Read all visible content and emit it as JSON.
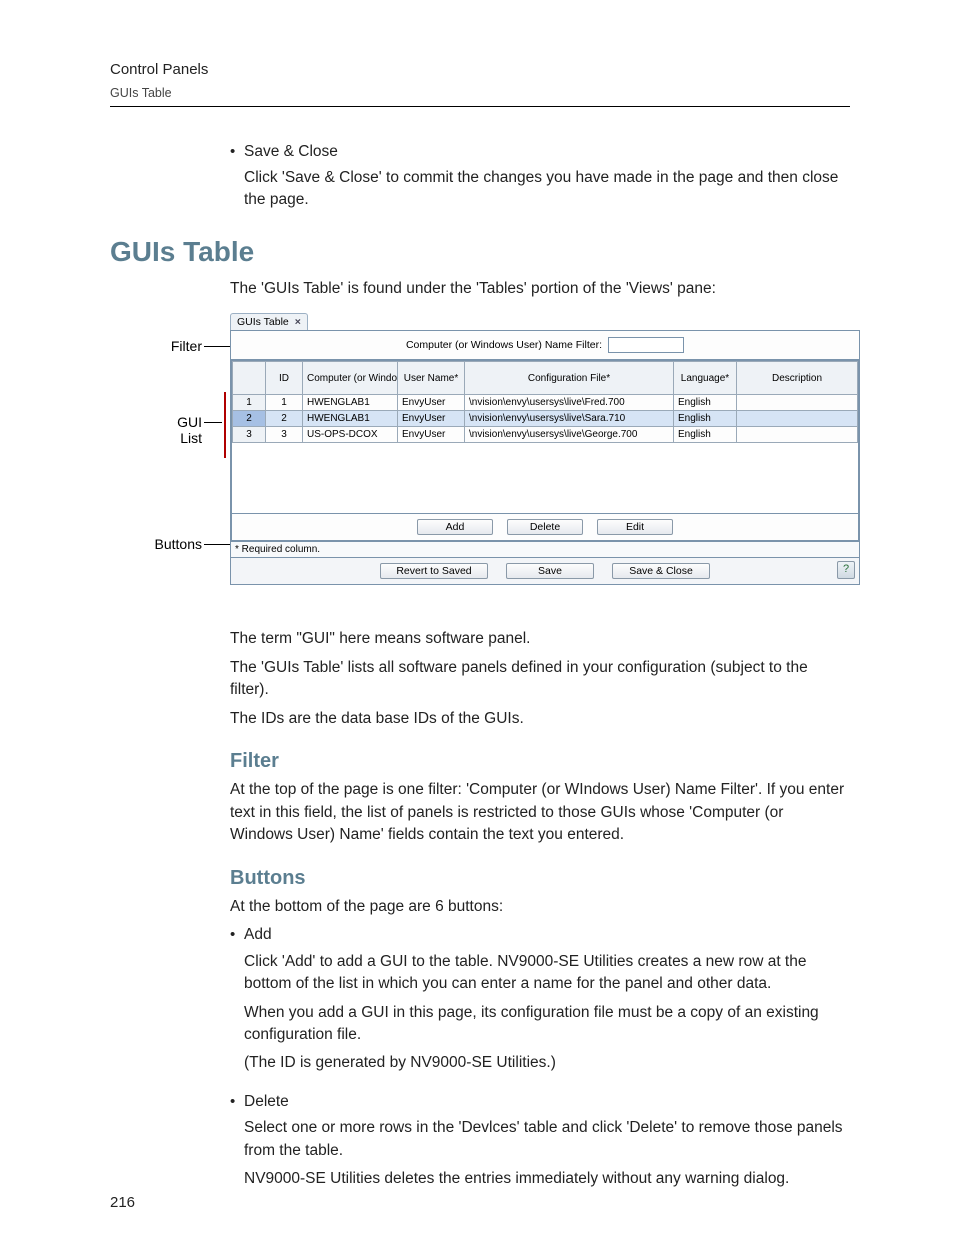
{
  "header": {
    "title": "Control Panels",
    "subtitle": "GUIs Table"
  },
  "intro_bullet": {
    "label": "Save & Close",
    "desc": "Click 'Save & Close' to commit the changes you have made in the page and then close the page."
  },
  "h1": "GUIs Table",
  "p1": "The 'GUIs Table' is found under the 'Tables' portion of the 'Views' pane:",
  "callouts": {
    "filter": "Filter",
    "gui_list_l1": "GUI",
    "gui_list_l2": "List",
    "buttons": "Buttons"
  },
  "app": {
    "tab": "GUIs Table",
    "filter_label": "Computer (or Windows User) Name Filter:",
    "filter_value": "",
    "columns": {
      "blank": "",
      "id": "ID",
      "name": "Computer (or Windows User) Name*",
      "user": "User Name*",
      "cfg": "Configuration File*",
      "lang": "Language*",
      "desc": "Description"
    },
    "rows": [
      {
        "n": "1",
        "id": "1",
        "name": "HWENGLAB1",
        "user": "EnvyUser",
        "cfg": "\\nvision\\envy\\usersys\\live\\Fred.700",
        "lang": "English",
        "desc": ""
      },
      {
        "n": "2",
        "id": "2",
        "name": "HWENGLAB1",
        "user": "EnvyUser",
        "cfg": "\\nvision\\envy\\usersys\\live\\Sara.710",
        "lang": "English",
        "desc": ""
      },
      {
        "n": "3",
        "id": "3",
        "name": "US-OPS-DCOX",
        "user": "EnvyUser",
        "cfg": "\\nvision\\envy\\usersys\\live\\George.700",
        "lang": "English",
        "desc": ""
      }
    ],
    "action_buttons": {
      "add": "Add",
      "delete": "Delete",
      "edit": "Edit"
    },
    "req_note": "* Required column.",
    "bottom_buttons": {
      "revert": "Revert to Saved",
      "save": "Save",
      "save_close": "Save & Close"
    },
    "help": "?"
  },
  "after_fig": {
    "p1": "The term \"GUI\" here means software panel.",
    "p2": "The 'GUIs Table' lists all software panels defined in your configuration (subject to the filter).",
    "p3": "The IDs are the data base IDs of the GUIs."
  },
  "filter_section": {
    "heading": "Filter",
    "p1": "At the top of the page is one filter: 'Computer (or WIndows User) Name Filter'. If you enter text in this field, the list of panels is restricted to those GUIs whose 'Computer (or Windows User) Name' fields contain the text you entered."
  },
  "buttons_section": {
    "heading": "Buttons",
    "intro": "At the bottom of the page are 6 buttons:",
    "items": [
      {
        "label": "Add",
        "paras": [
          "Click 'Add' to add a GUI to the table. NV9000-SE Utilities creates a new row at the bottom of the list in which you can enter a name for the panel and other data.",
          "When you add a GUI in this page, its configuration file must be a copy of an existing configuration file.",
          "(The ID is generated by NV9000-SE Utilities.)"
        ]
      },
      {
        "label": "Delete",
        "paras": [
          "Select one or more rows in the 'Devlces' table and click 'Delete' to remove those panels from the table.",
          "NV9000-SE Utilities deletes the entries immediately without any warning dialog."
        ]
      }
    ]
  },
  "page_number": "216"
}
